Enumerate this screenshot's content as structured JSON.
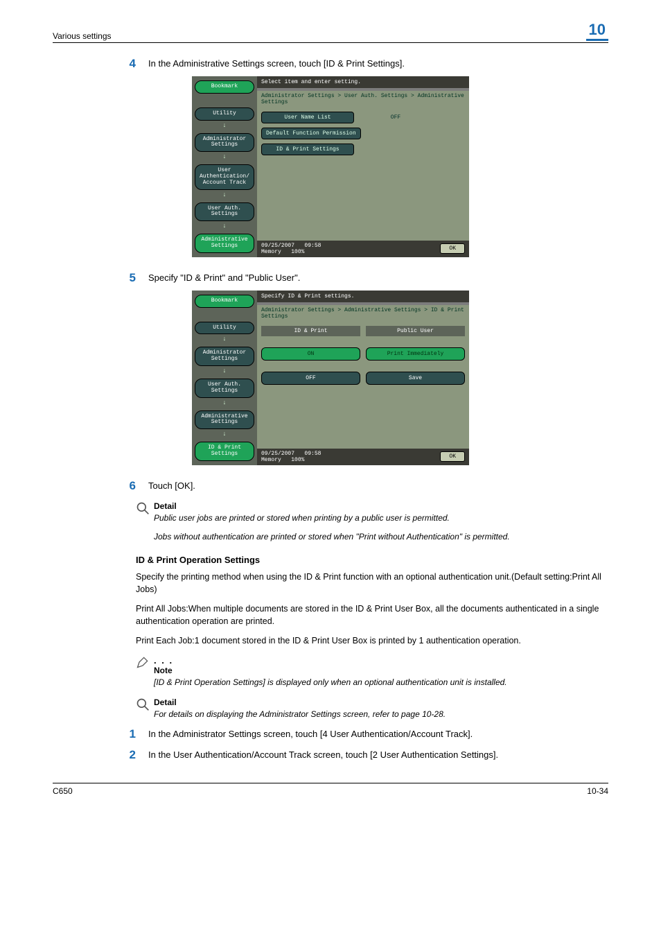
{
  "header": {
    "section": "Various settings",
    "chapter": "10"
  },
  "steps": {
    "s4": {
      "n": "4",
      "text": "In the Administrative Settings screen, touch [ID & Print Settings]."
    },
    "s5": {
      "n": "5",
      "text": "Specify \"ID & Print\" and \"Public User\"."
    },
    "s6": {
      "n": "6",
      "text": "Touch [OK]."
    },
    "s1": {
      "n": "1",
      "text": "In the Administrator Settings screen, touch [4 User Authentication/Account Track]."
    },
    "s2": {
      "n": "2",
      "text": "In the User Authentication/Account Track screen, touch [2 User Authentication Settings]."
    }
  },
  "screen1": {
    "title": "Select item and enter setting.",
    "crumb": "Administrator Settings > User Auth. Settings > Administrative Settings",
    "side": {
      "bookmark": "Bookmark",
      "items": [
        "Utility",
        "Administrator Settings",
        "User Authentication/ Account Track",
        "User Auth. Settings",
        "Administrative Settings"
      ]
    },
    "menu": {
      "user_name_list": "User Name List",
      "user_name_list_val": "OFF",
      "default_perm": "Default Function Permission",
      "id_print": "ID & Print Settings"
    },
    "footer": {
      "date": "09/25/2007",
      "time": "09:58",
      "mem_label": "Memory",
      "mem_val": "100%",
      "ok": "OK"
    }
  },
  "screen2": {
    "title": "Specify ID & Print settings.",
    "crumb": "Administrator Settings > Administrative Settings > ID & Print Settings",
    "side": {
      "bookmark": "Bookmark",
      "items": [
        "Utility",
        "Administrator Settings",
        "User Auth. Settings",
        "Administrative Settings",
        "ID & Print Settings"
      ]
    },
    "cols": {
      "left_header": "ID & Print",
      "right_header": "Public User",
      "on": "ON",
      "off": "OFF",
      "print_immediately": "Print Immediately",
      "save": "Save"
    },
    "footer": {
      "date": "09/25/2007",
      "time": "09:58",
      "mem_label": "Memory",
      "mem_val": "100%",
      "ok": "OK"
    }
  },
  "callouts": {
    "detail1": {
      "label": "Detail",
      "line1": "Public user jobs are printed or stored when printing by a public user is permitted.",
      "line2": "Jobs without authentication are printed or stored when \"Print without Authentication\" is permitted."
    },
    "note": {
      "label": "Note",
      "text": "[ID & Print Operation Settings] is displayed only when an optional authentication unit is installed."
    },
    "detail2": {
      "label": "Detail",
      "text": "For details on displaying the Administrator Settings screen, refer to page 10-28."
    }
  },
  "subsection": {
    "heading": "ID & Print Operation Settings",
    "p1": "Specify the printing method when using the ID & Print function with an optional authentication unit.(Default setting:Print All Jobs)",
    "p2": "Print All Jobs:When multiple documents are stored in the ID & Print User Box, all the documents authenticated in a single authentication operation are printed.",
    "p3": "Print Each Job:1 document stored in the ID & Print User Box is printed by 1 authentication operation."
  },
  "footer": {
    "left": "C650",
    "right": "10-34"
  }
}
